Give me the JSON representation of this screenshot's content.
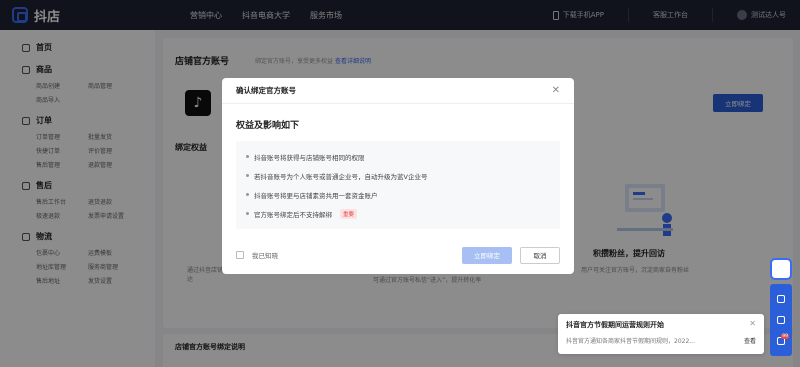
{
  "topbar": {
    "logo_text": "抖店",
    "nav": [
      "营销中心",
      "抖音电商大学",
      "服务市场"
    ],
    "download_app": "下载手机APP",
    "service_workbench": "客服工作台",
    "user": "测试达人号"
  },
  "sidebar": {
    "groups": [
      {
        "title": "首页",
        "items": []
      },
      {
        "title": "商品",
        "items": [
          "商品创建",
          "商品管理",
          "商品导入",
          ""
        ]
      },
      {
        "title": "订单",
        "items": [
          "订单管理",
          "批量发货",
          "快捷订单",
          "评价管理",
          "售后管理",
          "退款管理"
        ]
      },
      {
        "title": "售后",
        "items": [
          "售后工作台",
          "退货退款",
          "极速退款",
          "发票申请设置"
        ]
      },
      {
        "title": "物流",
        "items": [
          "包裹中心",
          "运费模板",
          "地址库管理",
          "服务商管理",
          "售后地址",
          "发货设置"
        ]
      }
    ]
  },
  "main": {
    "card_title": "店铺官方账号",
    "card_subtitle": "绑定官方账号，享受更多权益",
    "card_link": "查看详细说明",
    "bind_now": "立即绑定",
    "section_title": "绑定权益",
    "benefit_right_title": "积攒粉丝，提升回访",
    "benefit_right_desc": "用户可关注官方账号，沉淀商家自有粉丝",
    "benefit_left_desc": "通过抖音店铺与官方账号共享商品，完成快速触达",
    "benefit_mid_desc": "可通过官方账号私信“进入”，提升转化率",
    "bottom_card_title": "店铺官方账号绑定说明"
  },
  "modal": {
    "title": "确认绑定官方账号",
    "heading": "权益及影响如下",
    "items": [
      "抖音账号将获得与店铺账号相同的权限",
      "若抖音账号为个人账号或普通企业号，自动升级为蓝V企业号",
      "抖音账号将更与店铺素资共用一套资金账户",
      "官方账号绑定后不支持解绑"
    ],
    "important_tag": "重要",
    "checkbox_label": "我已知晓",
    "confirm": "立即绑定",
    "cancel": "取消"
  },
  "notification": {
    "title": "抖音官方节假期间运营规则开始",
    "desc": "抖音官方通知各商家抖音节假期间规则，2022...",
    "more": "查看"
  },
  "dock": {
    "badge": "99"
  },
  "colors": {
    "topbar": "#1e2333",
    "primary": "#2b5fd9",
    "primary_disabled": "#a8bff3",
    "important": "#e34d4d"
  }
}
